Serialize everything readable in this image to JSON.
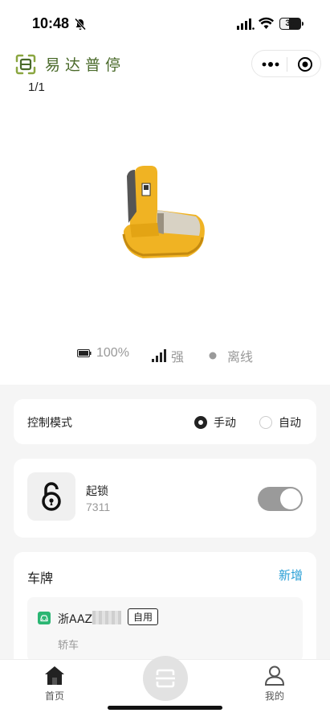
{
  "status": {
    "time": "10:48",
    "battery": "39"
  },
  "app": {
    "title": "易达普停"
  },
  "gallery": {
    "indicator": "1/1"
  },
  "device": {
    "battery": "100%",
    "signal": "强",
    "online": "离线"
  },
  "control_mode": {
    "label": "控制模式",
    "options": [
      {
        "label": "手动",
        "selected": true
      },
      {
        "label": "自动",
        "selected": false
      }
    ]
  },
  "lock": {
    "title": "起锁",
    "code": "7311",
    "toggle_on": true
  },
  "plates": {
    "title": "车牌",
    "add_label": "新增",
    "items": [
      {
        "number": "浙AAZ",
        "tag": "自用",
        "type": "轿车"
      }
    ]
  },
  "tabbar": {
    "home": "首页",
    "mine": "我的"
  },
  "colors": {
    "title": "#4a6a2a",
    "link": "#2a9fd6",
    "plate_icon": "#2bb673",
    "device": "#f0b323"
  }
}
